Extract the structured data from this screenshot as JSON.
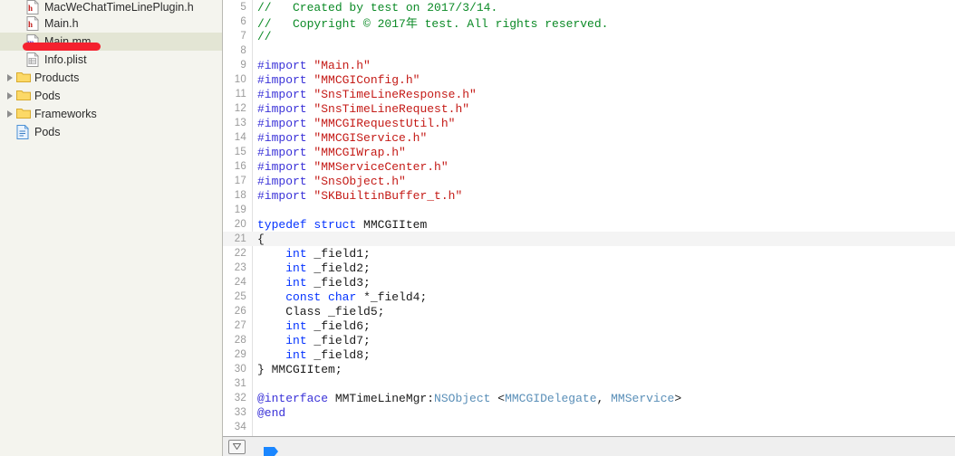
{
  "sidebar": {
    "items": [
      {
        "label": "MacWeChatTimeLinePlugin.h",
        "icon": "header-file-icon",
        "kind": "file-h",
        "indent": 1,
        "selected": false,
        "clipped": true
      },
      {
        "label": "Main.h",
        "icon": "header-file-icon",
        "kind": "file-h",
        "indent": 1,
        "selected": false
      },
      {
        "label": "Main.mm",
        "icon": "objcpp-file-icon",
        "kind": "file-mm",
        "indent": 1,
        "selected": true
      },
      {
        "label": "Info.plist",
        "icon": "plist-file-icon",
        "kind": "file-plist",
        "indent": 1,
        "selected": false
      },
      {
        "label": "Products",
        "icon": "folder-icon",
        "kind": "group",
        "indent": 0,
        "selected": false
      },
      {
        "label": "Pods",
        "icon": "folder-icon",
        "kind": "group",
        "indent": 0,
        "selected": false
      },
      {
        "label": "Frameworks",
        "icon": "folder-icon",
        "kind": "group",
        "indent": 0,
        "selected": false
      },
      {
        "label": "Pods",
        "icon": "project-file-icon",
        "kind": "project",
        "indent": 0,
        "selected": false
      }
    ],
    "annotation": {
      "shape": "rounded-capsule",
      "color": "#f4212e"
    },
    "colors": {
      "background": "#f4f4ee",
      "selected_row": "#e3e5d4"
    }
  },
  "editor": {
    "current_line": 21,
    "colors": {
      "comment": "#0b8a26",
      "preprocessor": "#3a32d8",
      "string": "#c41a16",
      "keyword": "#0433ff",
      "class": "#5a8fb8",
      "plain": "#1a1a1a",
      "current_line_bg": "#f4f4f4",
      "gutter_text": "#9a9a9a"
    },
    "lines": [
      {
        "n": 5,
        "tokens": [
          {
            "t": "//   Created by test on 2017/3/14.",
            "c": "cmt"
          }
        ]
      },
      {
        "n": 6,
        "tokens": [
          {
            "t": "//   Copyright © 2017年 test. All rights reserved.",
            "c": "cmt"
          }
        ]
      },
      {
        "n": 7,
        "tokens": [
          {
            "t": "//",
            "c": "cmt"
          }
        ]
      },
      {
        "n": 8,
        "tokens": []
      },
      {
        "n": 9,
        "tokens": [
          {
            "t": "#import ",
            "c": "pre"
          },
          {
            "t": "\"Main.h\"",
            "c": "str"
          }
        ]
      },
      {
        "n": 10,
        "tokens": [
          {
            "t": "#import ",
            "c": "pre"
          },
          {
            "t": "\"MMCGIConfig.h\"",
            "c": "str"
          }
        ]
      },
      {
        "n": 11,
        "tokens": [
          {
            "t": "#import ",
            "c": "pre"
          },
          {
            "t": "\"SnsTimeLineResponse.h\"",
            "c": "str"
          }
        ]
      },
      {
        "n": 12,
        "tokens": [
          {
            "t": "#import ",
            "c": "pre"
          },
          {
            "t": "\"SnsTimeLineRequest.h\"",
            "c": "str"
          }
        ]
      },
      {
        "n": 13,
        "tokens": [
          {
            "t": "#import ",
            "c": "pre"
          },
          {
            "t": "\"MMCGIRequestUtil.h\"",
            "c": "str"
          }
        ]
      },
      {
        "n": 14,
        "tokens": [
          {
            "t": "#import ",
            "c": "pre"
          },
          {
            "t": "\"MMCGIService.h\"",
            "c": "str"
          }
        ]
      },
      {
        "n": 15,
        "tokens": [
          {
            "t": "#import ",
            "c": "pre"
          },
          {
            "t": "\"MMCGIWrap.h\"",
            "c": "str"
          }
        ]
      },
      {
        "n": 16,
        "tokens": [
          {
            "t": "#import ",
            "c": "pre"
          },
          {
            "t": "\"MMServiceCenter.h\"",
            "c": "str"
          }
        ]
      },
      {
        "n": 17,
        "tokens": [
          {
            "t": "#import ",
            "c": "pre"
          },
          {
            "t": "\"SnsObject.h\"",
            "c": "str"
          }
        ]
      },
      {
        "n": 18,
        "tokens": [
          {
            "t": "#import ",
            "c": "pre"
          },
          {
            "t": "\"SKBuiltinBuffer_t.h\"",
            "c": "str"
          }
        ]
      },
      {
        "n": 19,
        "tokens": []
      },
      {
        "n": 20,
        "tokens": [
          {
            "t": "typedef",
            "c": "kw"
          },
          {
            "t": " ",
            "c": "pln"
          },
          {
            "t": "struct",
            "c": "kw"
          },
          {
            "t": " MMCGIItem",
            "c": "pln"
          }
        ]
      },
      {
        "n": 21,
        "tokens": [
          {
            "t": "{",
            "c": "pln"
          }
        ]
      },
      {
        "n": 22,
        "tokens": [
          {
            "t": "    ",
            "c": "pln"
          },
          {
            "t": "int",
            "c": "kw"
          },
          {
            "t": " _field1;",
            "c": "pln"
          }
        ]
      },
      {
        "n": 23,
        "tokens": [
          {
            "t": "    ",
            "c": "pln"
          },
          {
            "t": "int",
            "c": "kw"
          },
          {
            "t": " _field2;",
            "c": "pln"
          }
        ]
      },
      {
        "n": 24,
        "tokens": [
          {
            "t": "    ",
            "c": "pln"
          },
          {
            "t": "int",
            "c": "kw"
          },
          {
            "t": " _field3;",
            "c": "pln"
          }
        ]
      },
      {
        "n": 25,
        "tokens": [
          {
            "t": "    ",
            "c": "pln"
          },
          {
            "t": "const",
            "c": "kw"
          },
          {
            "t": " ",
            "c": "pln"
          },
          {
            "t": "char",
            "c": "kw"
          },
          {
            "t": " *_field4;",
            "c": "pln"
          }
        ]
      },
      {
        "n": 26,
        "tokens": [
          {
            "t": "    Class _field5;",
            "c": "pln"
          }
        ]
      },
      {
        "n": 27,
        "tokens": [
          {
            "t": "    ",
            "c": "pln"
          },
          {
            "t": "int",
            "c": "kw"
          },
          {
            "t": " _field6;",
            "c": "pln"
          }
        ]
      },
      {
        "n": 28,
        "tokens": [
          {
            "t": "    ",
            "c": "pln"
          },
          {
            "t": "int",
            "c": "kw"
          },
          {
            "t": " _field7;",
            "c": "pln"
          }
        ]
      },
      {
        "n": 29,
        "tokens": [
          {
            "t": "    ",
            "c": "pln"
          },
          {
            "t": "int",
            "c": "kw"
          },
          {
            "t": " _field8;",
            "c": "pln"
          }
        ]
      },
      {
        "n": 30,
        "tokens": [
          {
            "t": "} MMCGIItem;",
            "c": "pln"
          }
        ]
      },
      {
        "n": 31,
        "tokens": []
      },
      {
        "n": 32,
        "tokens": [
          {
            "t": "@interface",
            "c": "typ"
          },
          {
            "t": " MMTimeLineMgr:",
            "c": "pln"
          },
          {
            "t": "NSObject",
            "c": "cls"
          },
          {
            "t": " <",
            "c": "pln"
          },
          {
            "t": "MMCGIDelegate",
            "c": "cls"
          },
          {
            "t": ", ",
            "c": "pln"
          },
          {
            "t": "MMService",
            "c": "cls"
          },
          {
            "t": ">",
            "c": "pln"
          }
        ]
      },
      {
        "n": 33,
        "tokens": [
          {
            "t": "@end",
            "c": "typ"
          }
        ]
      },
      {
        "n": 34,
        "tokens": []
      }
    ]
  },
  "bottom_bar": {
    "filter_icon": "filter-triangle-icon",
    "breadcrumb_icon": "breadcrumb-arrow-icon"
  }
}
